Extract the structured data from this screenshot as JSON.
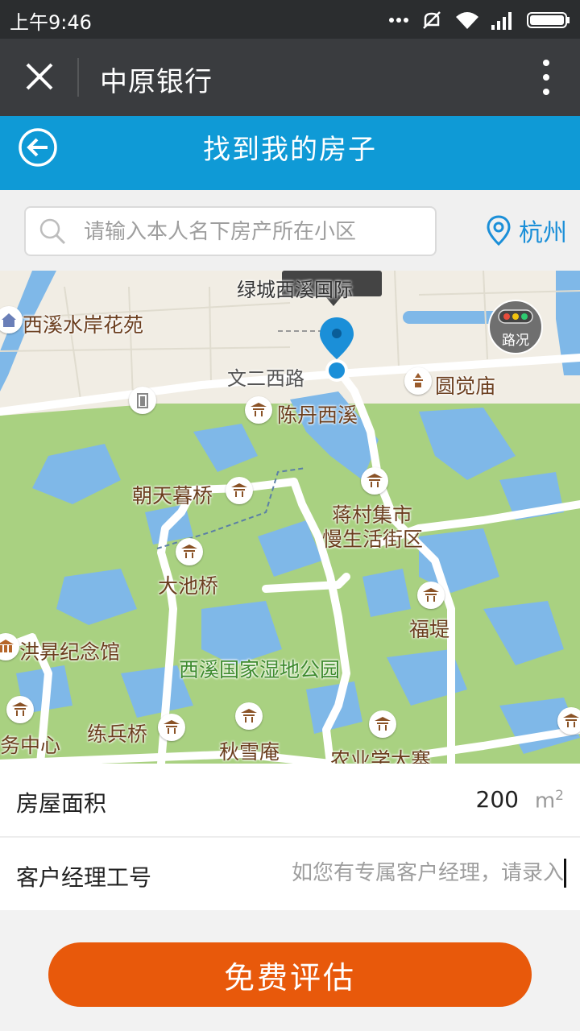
{
  "status_bar": {
    "time": "上午9:46"
  },
  "wechat_bar": {
    "title": "中原银行"
  },
  "header": {
    "title": "找到我的房子"
  },
  "search": {
    "placeholder": "请输入本人名下房产所在小区",
    "city": "杭州"
  },
  "map": {
    "traffic_button": "路况",
    "marker_label": "绿城西溪国际",
    "roads": [
      "文二西路"
    ],
    "pois": [
      "西溪水岸花苑",
      "圆觉庙",
      "陈丹西溪",
      "朝天暮桥",
      "蒋村集市",
      "慢生活街区",
      "大池桥",
      "福堤",
      "洪昇纪念馆",
      "西溪国家湿地公园",
      "练兵桥",
      "秋雪庵",
      "农业学大寨",
      "务中心"
    ]
  },
  "form": {
    "area_label": "房屋面积",
    "area_value": "200",
    "area_unit": "m",
    "area_unit_sup": "2",
    "manager_label": "客户经理工号",
    "manager_placeholder": "如您有专属客户经理，请录入"
  },
  "submit_label": "免费评估",
  "colors": {
    "header_blue": "#0f9ad6",
    "accent_orange": "#e8590b",
    "link_blue": "#1b8fd8"
  }
}
